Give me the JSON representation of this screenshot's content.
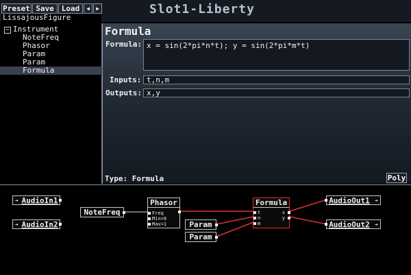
{
  "toolbar": {
    "preset_label": "Preset",
    "save_label": "Save",
    "load_label": "Load",
    "prev_label": "◀",
    "next_label": "▶",
    "preset_name": "LissajousFigure"
  },
  "app_title": "Slot1-Liberty",
  "tree": {
    "expander": "−",
    "root": "Instrument",
    "items": [
      "NoteFreq",
      "Phasor",
      "Param",
      "Param",
      "Formula"
    ],
    "selected_index": 4
  },
  "panel": {
    "title": "Formula",
    "formula_label": "Formula:",
    "formula_value": "x = sin(2*pi*n*t); y = sin(2*pi*m*t)",
    "inputs_label": "Inputs:",
    "inputs_value": "t,n,m",
    "outputs_label": "Outputs:",
    "outputs_value": "x,y",
    "type_label": "Type: Formula",
    "poly_label": "Poly"
  },
  "graph": {
    "audioin1": "AudioIn1",
    "audioin2": "AudioIn2",
    "notefreq": "NoteFreq",
    "phasor": {
      "label": "Phasor",
      "ports": [
        "Freq",
        "Min=0",
        "Max=1"
      ]
    },
    "param1": "Param",
    "param2": "Param",
    "formula": {
      "label": "Formula",
      "inputs": [
        "t",
        "n",
        "m"
      ],
      "outputs": [
        "x",
        "y"
      ]
    },
    "audioout1": "AudioOut1",
    "audioout2": "AudioOut2",
    "wire_color": "#e03030"
  }
}
